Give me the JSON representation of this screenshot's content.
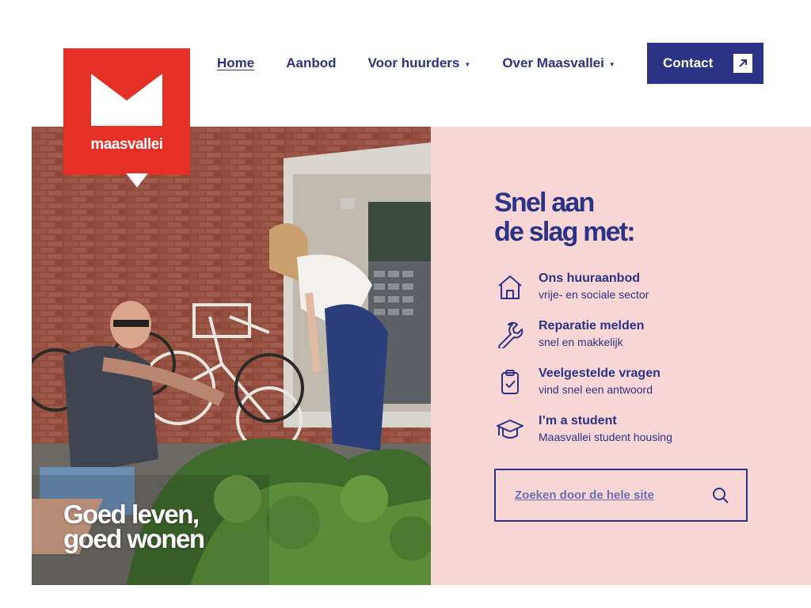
{
  "brand": {
    "name": "maasvallei",
    "logo_color": "#e43027",
    "primary_color": "#2b3384",
    "panel_color": "#f8d6d6"
  },
  "nav": {
    "items": [
      {
        "label": "Home",
        "active": true,
        "has_dropdown": false
      },
      {
        "label": "Aanbod",
        "active": false,
        "has_dropdown": false
      },
      {
        "label": "Voor huurders",
        "active": false,
        "has_dropdown": true
      },
      {
        "label": "Over Maasvallei",
        "active": false,
        "has_dropdown": true
      }
    ],
    "contact_label": "Contact",
    "contact_icon": "arrow-up-right-icon",
    "dropdown_icon": "caret-down-icon"
  },
  "hero": {
    "title_line1": "Goed leven,",
    "title_line2": "goed wonen"
  },
  "quicklinks": {
    "title_line1": "Snel aan",
    "title_line2": "de slag met:",
    "items": [
      {
        "title": "Ons huuraanbod",
        "subtitle": "vrije- en sociale sector",
        "icon": "house-icon"
      },
      {
        "title": "Reparatie melden",
        "subtitle": "snel en makkelijk",
        "icon": "wrench-icon"
      },
      {
        "title": "Veelgestelde vragen",
        "subtitle": "vind snel een antwoord",
        "icon": "clipboard-check-icon"
      },
      {
        "title": "I’m a student",
        "subtitle": "Maasvallei student housing",
        "icon": "graduation-cap-icon"
      }
    ]
  },
  "search": {
    "placeholder": "Zoeken door de hele site",
    "value": "",
    "icon": "search-icon"
  }
}
